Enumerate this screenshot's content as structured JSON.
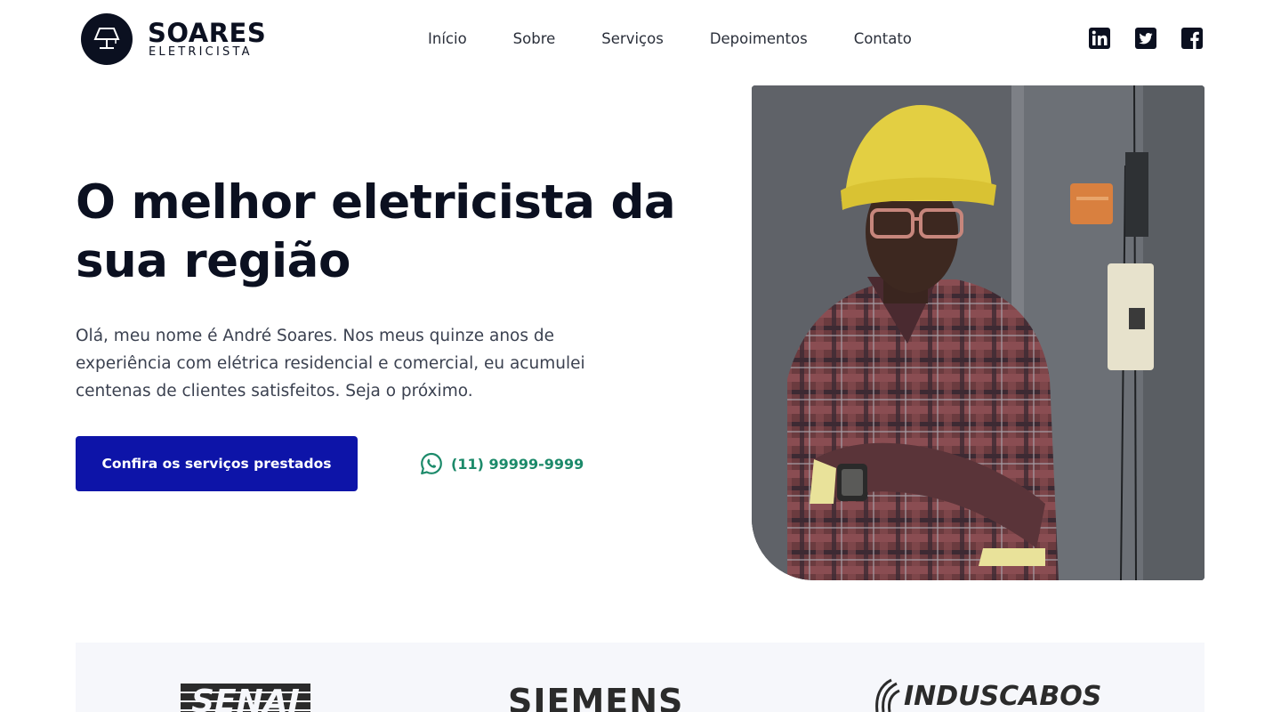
{
  "brand": {
    "name": "SOARES",
    "subtitle": "ELETRICISTA",
    "logo_icon": "lamp-icon"
  },
  "nav": {
    "items": [
      {
        "label": "Início"
      },
      {
        "label": "Sobre"
      },
      {
        "label": "Serviços"
      },
      {
        "label": "Depoimentos"
      },
      {
        "label": "Contato"
      }
    ]
  },
  "social": {
    "icons": [
      "linkedin-icon",
      "twitter-icon",
      "facebook-icon"
    ]
  },
  "hero": {
    "title_line1": "O melhor eletricista da",
    "title_line2": "sua região",
    "description": "Olá, meu nome é André Soares. Nos meus quinze anos de experiência com elétrica residencial e comercial, eu acumulei centenas de clientes satisfeitos. Seja o próximo.",
    "cta_label": "Confira os serviços prestados",
    "phone": "(11) 99999-9999",
    "phone_icon": "whatsapp-icon"
  },
  "partners": [
    {
      "name": "SENAI"
    },
    {
      "name": "SIEMENS"
    },
    {
      "name": "INDUSCABOS"
    }
  ],
  "colors": {
    "primary": "#0d14a8",
    "dark": "#0b1020",
    "whatsapp": "#1c8a6a",
    "partners_bg": "#f6f7fb"
  }
}
